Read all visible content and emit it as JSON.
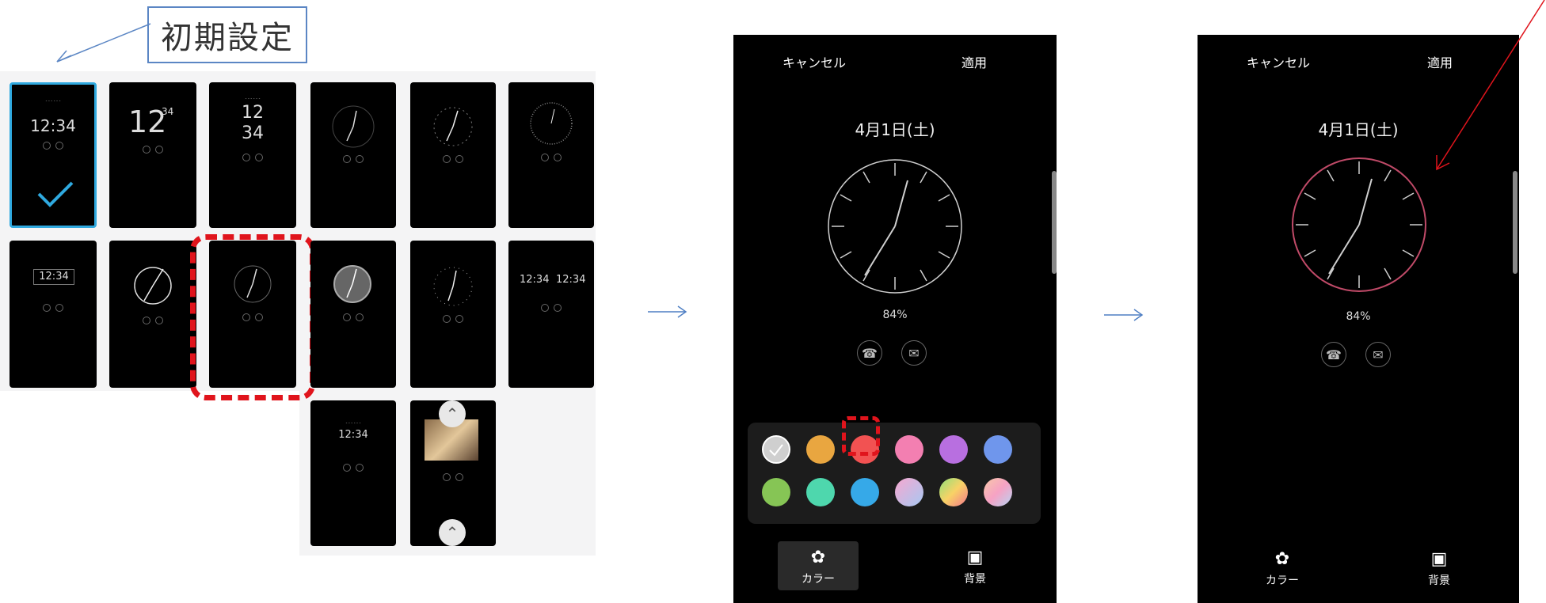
{
  "callout": {
    "label": "初期設定"
  },
  "thumbs": {
    "time": "12:34",
    "hour": "12",
    "minute": "34",
    "digital_time": "12:34"
  },
  "phone1": {
    "cancel": "キャンセル",
    "apply": "適用",
    "date": "4月1日(土)",
    "battery": "84%",
    "tabs": {
      "color": "カラー",
      "background": "背景"
    },
    "clock_color": "#cfcfcf"
  },
  "phone2": {
    "cancel": "キャンセル",
    "apply": "適用",
    "date": "4月1日(土)",
    "battery": "84%",
    "tabs": {
      "color": "カラー",
      "background": "背景"
    },
    "clock_color": "#c04a68"
  },
  "palette_colors": [
    "#cfcfcf",
    "#e9a640",
    "#f25252",
    "#f37fb1",
    "#b86fe0",
    "#6f96ec",
    "#86c555",
    "#4ed7ad",
    "#36a9e8",
    "gradient-pastel",
    "gradient-rainbow",
    "gradient-peach"
  ],
  "icons": {
    "flow_arrow": "right-arrow-icon",
    "selected_check": "checkmark-icon",
    "palette": "palette-icon",
    "background": "image-icon",
    "missed_call": "missed-call-icon",
    "message": "message-icon"
  }
}
